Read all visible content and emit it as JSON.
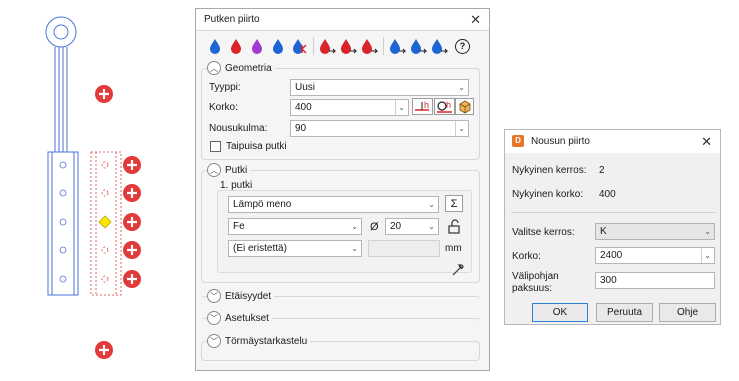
{
  "drawing": {
    "colors": {
      "pipe": "#4a72d8",
      "riser": "#e03b3b",
      "marker": "#e23a3a",
      "highlight": "#ffe600"
    }
  },
  "panel": {
    "title": "Putken piirto",
    "toolbar_icons": [
      "drop-blue-icon",
      "drop-red-icon",
      "drop-purple-icon",
      "drop-blue-icon",
      "drop-blue-k-icon",
      "drop-red-arrow-icon",
      "drop-red-arrow-icon",
      "drop-red-arrow-icon",
      "drop-blue-arrow-icon",
      "drop-blue-arrow-icon",
      "drop-blue-arrow-icon",
      "help-icon"
    ],
    "help_glyph": "?",
    "geometry": {
      "header": "Geometria",
      "type_label": "Tyyppi:",
      "type_value": "Uusi",
      "height_label": "Korko:",
      "height_value": "400",
      "slope_label": "Nousukulma:",
      "slope_value": "90",
      "flexible_label": "Taipuisa putki"
    },
    "pipe": {
      "header": "Putki",
      "subheader": "1. putki",
      "medium": "Lämpö meno",
      "material": "Fe",
      "diameter_symbol": "Ø",
      "diameter": "20",
      "insulation": "(Ei eristettä)",
      "unit": "mm"
    },
    "collapsed_sections": [
      "Etäisyydet",
      "Asetukset",
      "Törmäystarkastelu"
    ]
  },
  "dialog": {
    "title": "Nousun piirto",
    "app_icon_letter": "D",
    "current_floor_label": "Nykyinen kerros:",
    "current_floor_value": "2",
    "current_height_label": "Nykyinen korko:",
    "current_height_value": "400",
    "select_floor_label": "Valitse kerros:",
    "select_floor_value": "K",
    "height_label": "Korko:",
    "height_value": "2400",
    "slab_label_line1": "Välipohjan",
    "slab_label_line2": "paksuus:",
    "slab_value": "300",
    "ok": "OK",
    "cancel": "Peruuta",
    "help": "Ohje"
  }
}
